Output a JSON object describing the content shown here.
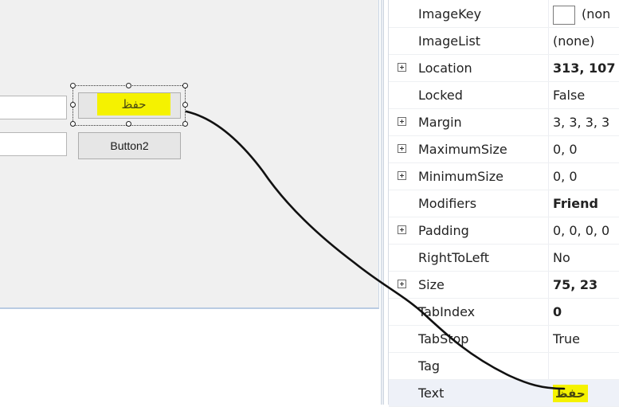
{
  "designer": {
    "button1_text": "حفظ",
    "button2_text": "Button2"
  },
  "properties": [
    {
      "name": "ImageKey",
      "value": "(non",
      "expandable": false,
      "bold": false,
      "swatch": true
    },
    {
      "name": "ImageList",
      "value": "(none)",
      "expandable": false,
      "bold": false
    },
    {
      "name": "Location",
      "value": "313, 107",
      "expandable": true,
      "bold": true
    },
    {
      "name": "Locked",
      "value": "False",
      "expandable": false,
      "bold": false
    },
    {
      "name": "Margin",
      "value": "3, 3, 3, 3",
      "expandable": true,
      "bold": false
    },
    {
      "name": "MaximumSize",
      "value": "0, 0",
      "expandable": true,
      "bold": false
    },
    {
      "name": "MinimumSize",
      "value": "0, 0",
      "expandable": true,
      "bold": false
    },
    {
      "name": "Modifiers",
      "value": "Friend",
      "expandable": false,
      "bold": true
    },
    {
      "name": "Padding",
      "value": "0, 0, 0, 0",
      "expandable": true,
      "bold": false
    },
    {
      "name": "RightToLeft",
      "value": "No",
      "expandable": false,
      "bold": false
    },
    {
      "name": "Size",
      "value": "75, 23",
      "expandable": true,
      "bold": true
    },
    {
      "name": "TabIndex",
      "value": "0",
      "expandable": false,
      "bold": true
    },
    {
      "name": "TabStop",
      "value": "True",
      "expandable": false,
      "bold": false
    },
    {
      "name": "Tag",
      "value": "",
      "expandable": false,
      "bold": false
    },
    {
      "name": "Text",
      "value": "حفظ",
      "expandable": false,
      "bold": true,
      "highlight": true
    }
  ],
  "colors": {
    "highlight": "#f5f200",
    "annotation_stroke": "#111111"
  }
}
